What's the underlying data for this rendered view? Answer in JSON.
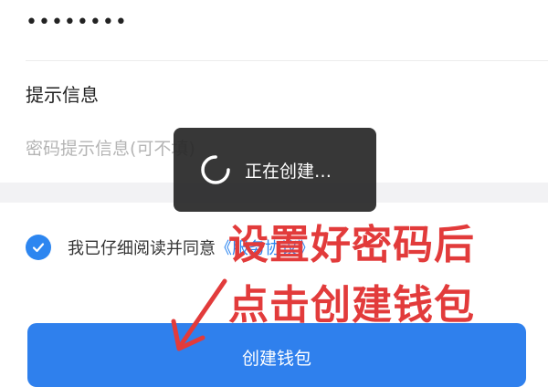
{
  "password": {
    "masked_value": "••••••••"
  },
  "hint": {
    "label": "提示信息",
    "placeholder": "密码提示信息(可不填)"
  },
  "agreement": {
    "checked": true,
    "text": "我已仔细阅读并同意",
    "link": "《服务协议》"
  },
  "create_button": {
    "label": "创建钱包"
  },
  "loading_toast": {
    "text": "正在创建…"
  },
  "annotation": {
    "line1": "设置好密码后",
    "line2": "点击创建钱包"
  },
  "colors": {
    "accent": "#2f80ed",
    "annotation_red": "#e23b3b",
    "toast_bg": "#262626"
  },
  "icons": {
    "checkbox": "check-icon",
    "spinner": "spinner-icon",
    "arrow": "arrow-down-left-icon"
  }
}
